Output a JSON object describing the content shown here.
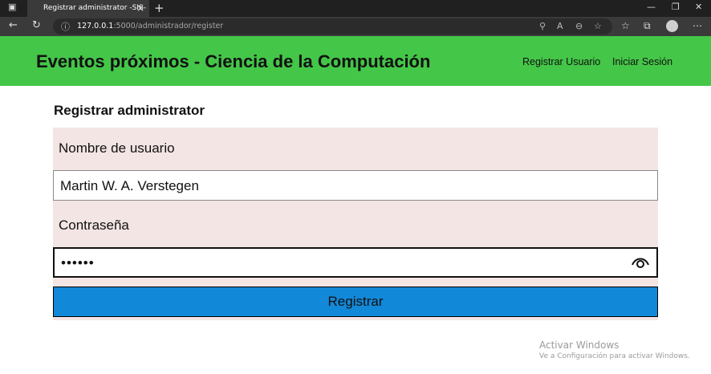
{
  "browser": {
    "tab_title": "Registrar administrator -SIS-PEC",
    "url_host": "127.0.0.1",
    "url_path": ":5000/administrador/register",
    "window_controls": [
      "minimize-icon",
      "restore-icon",
      "close-icon"
    ]
  },
  "navbar": {
    "brand": "Eventos próximos - Ciencia de la Computación",
    "links": [
      "Registrar Usuario",
      "Iniciar Sesión"
    ],
    "color": "#44c648"
  },
  "form": {
    "title": "Registrar administrator",
    "username_label": "Nombre de usuario",
    "username_value": "Martin W. A. Verstegen",
    "password_label": "Contraseña",
    "password_value": "••••••",
    "submit_label": "Registrar",
    "form_bg_color": "#f3e5e4",
    "submit_color": "#1288d8"
  },
  "watermark": {
    "line1": "Activar Windows",
    "line2": "Ve a Configuración para activar Windows."
  }
}
